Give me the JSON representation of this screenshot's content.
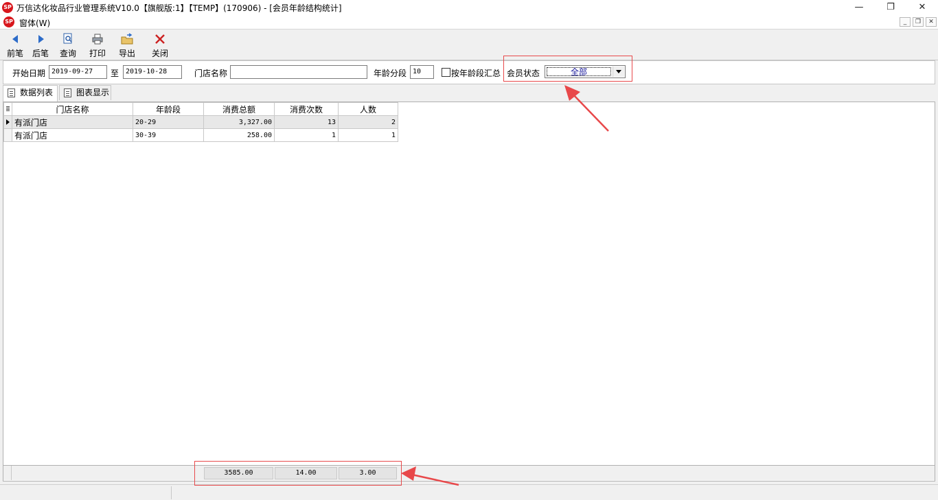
{
  "window": {
    "logo_text": "SP",
    "title": "万信达化妆品行业管理系统V10.0【旗舰版:1】【TEMP】(170906) - [会员年龄结构统计]",
    "controls": [
      "—",
      "❐",
      "✕"
    ]
  },
  "menubar": {
    "logo_text": "SP",
    "window_menu": "窗体(W)",
    "mdi_controls": [
      "_",
      "❐",
      "✕"
    ]
  },
  "toolbar": {
    "prev_label": "前笔",
    "next_label": "后笔",
    "query_label": "查询",
    "print_label": "打印",
    "export_label": "导出",
    "close_label": "关闭"
  },
  "filters": {
    "start_date_label": "开始日期",
    "start_date": "2019-09-27",
    "to_label": "至",
    "end_date": "2019-10-28",
    "store_name_label": "门店名称",
    "store_name": "",
    "age_segment_label": "年龄分段",
    "age_segment": "10",
    "summary_by_age_label": "按年龄段汇总",
    "summary_by_age_checked": false,
    "member_status_label": "会员状态",
    "member_status": "全部"
  },
  "tabs": [
    {
      "label": "数据列表",
      "active": true
    },
    {
      "label": "图表显示",
      "active": false
    }
  ],
  "grid": {
    "columns": [
      "门店名称",
      "年龄段",
      "消费总额",
      "消费次数",
      "人数"
    ],
    "rows": [
      {
        "store": "有派门店",
        "age_range": "20-29",
        "total": "3,327.00",
        "count": "13",
        "people": "2",
        "selected": true
      },
      {
        "store": "有派门店",
        "age_range": "30-39",
        "total": "258.00",
        "count": "1",
        "people": "1",
        "selected": false
      }
    ],
    "totals": {
      "total": "3585.00",
      "count": "14.00",
      "people": "3.00"
    }
  },
  "colors": {
    "annotation": "#e8484a",
    "toolbar_arrow": "#2d6cc9",
    "logo": "#d8161c",
    "close_icon": "#cc2222"
  }
}
